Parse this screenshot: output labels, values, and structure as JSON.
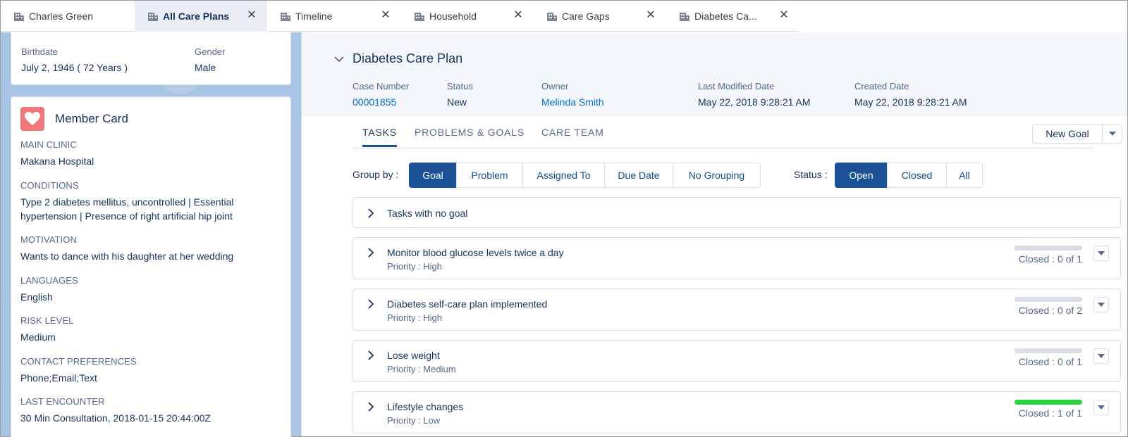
{
  "tabs": [
    {
      "label": "Charles Green",
      "closable": false,
      "active": false
    },
    {
      "label": "All Care Plans",
      "closable": true,
      "active": true
    },
    {
      "label": "Timeline",
      "closable": true,
      "active": false
    },
    {
      "label": "Household",
      "closable": true,
      "active": false
    },
    {
      "label": "Care Gaps",
      "closable": true,
      "active": false
    },
    {
      "label": "Diabetes Ca...",
      "closable": true,
      "active": false
    }
  ],
  "patient": {
    "birthdate_label": "Birthdate",
    "birthdate_value": "July 2, 1946 ( 72 Years )",
    "gender_label": "Gender",
    "gender_value": "Male"
  },
  "member_card": {
    "title": "Member Card",
    "icon": "heart-icon",
    "icon_color": "#f0787a",
    "sections": [
      {
        "label": "MAIN CLINIC",
        "value": "Makana Hospital"
      },
      {
        "label": "CONDITIONS",
        "value": "Type 2 diabetes mellitus, uncontrolled | Essential hypertension | Presence of right artificial hip joint"
      },
      {
        "label": "MOTIVATION",
        "value": "Wants to dance with his daughter at her wedding"
      },
      {
        "label": "LANGUAGES",
        "value": "English"
      },
      {
        "label": "RISK LEVEL",
        "value": "Medium"
      },
      {
        "label": "CONTACT PREFERENCES",
        "value": "Phone;Email;Text"
      },
      {
        "label": "LAST ENCOUNTER",
        "value": "30 Min Consultation, 2018-01-15 20:44:00Z"
      }
    ]
  },
  "care_plan": {
    "title": "Diabetes Care Plan",
    "meta": [
      {
        "label": "Case Number",
        "value": "00001855",
        "link": true
      },
      {
        "label": "Status",
        "value": "New",
        "link": false
      },
      {
        "label": "Owner",
        "value": "Melinda Smith",
        "link": true
      },
      {
        "label": "Last Modified Date",
        "value": "May 22, 2018 9:28:21 AM",
        "link": false
      },
      {
        "label": "Created Date",
        "value": "May 22, 2018 9:28:21 AM",
        "link": false
      }
    ]
  },
  "subtabs": [
    {
      "label": "TASKS",
      "active": true
    },
    {
      "label": "PROBLEMS & GOALS",
      "active": false
    },
    {
      "label": "CARE TEAM",
      "active": false
    }
  ],
  "new_goal_label": "New Goal",
  "group_by": {
    "label": "Group by :",
    "options": [
      "Goal",
      "Problem",
      "Assigned To",
      "Due Date",
      "No Grouping"
    ],
    "selected": "Goal"
  },
  "status_filter": {
    "label": "Status :",
    "options": [
      "Open",
      "Closed",
      "All"
    ],
    "selected": "Open"
  },
  "no_goal_row": {
    "title": "Tasks with no goal"
  },
  "goals": [
    {
      "title": "Monitor blood glucose levels twice a day",
      "priority": "Priority : High",
      "closed_text": "Closed : 0 of 1",
      "progress": 0.0
    },
    {
      "title": "Diabetes self-care plan implemented",
      "priority": "Priority : High",
      "closed_text": "Closed : 0 of 2",
      "progress": 0.0
    },
    {
      "title": "Lose weight",
      "priority": "Priority : Medium",
      "closed_text": "Closed : 0 of 1",
      "progress": 0.0
    },
    {
      "title": "Lifestyle changes",
      "priority": "Priority : Low",
      "closed_text": "Closed : 1 of 1",
      "progress": 1.0
    }
  ],
  "colors": {
    "accent": "#1b5297",
    "link": "#0070d2",
    "progress_complete": "#27d43b",
    "progress_track": "#d8dde6",
    "sidebar_bg": "#a9c3e5"
  }
}
